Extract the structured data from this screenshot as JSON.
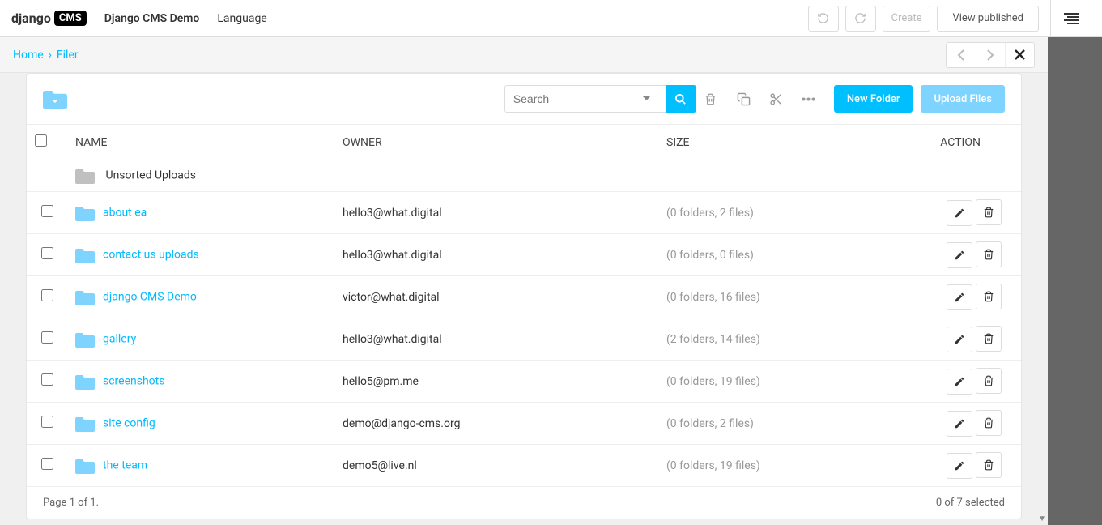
{
  "toolbar": {
    "logo_prefix": "django",
    "logo_badge": "CMS",
    "site_name": "Django CMS Demo",
    "language_label": "Language",
    "create_label": "Create",
    "view_published_label": "View published"
  },
  "breadcrumb": {
    "home": "Home",
    "separator": "›",
    "current": "Filer"
  },
  "panel_toolbar": {
    "search_placeholder": "Search",
    "new_folder_label": "New Folder",
    "upload_files_label": "Upload Files"
  },
  "table": {
    "headers": {
      "name": "NAME",
      "owner": "OWNER",
      "size": "SIZE",
      "action": "ACTION"
    },
    "unsorted_label": "Unsorted Uploads",
    "rows": [
      {
        "name": "about ea",
        "owner": "hello3@what.digital",
        "size": "(0 folders, 2 files)"
      },
      {
        "name": "contact us uploads",
        "owner": "hello3@what.digital",
        "size": "(0 folders, 0 files)"
      },
      {
        "name": "django CMS Demo",
        "owner": "victor@what.digital",
        "size": "(0 folders, 16 files)"
      },
      {
        "name": "gallery",
        "owner": "hello3@what.digital",
        "size": "(2 folders, 14 files)"
      },
      {
        "name": "screenshots",
        "owner": "hello5@pm.me",
        "size": "(0 folders, 19 files)"
      },
      {
        "name": "site config",
        "owner": "demo@django-cms.org",
        "size": "(0 folders, 2 files)"
      },
      {
        "name": "the team",
        "owner": "demo5@live.nl",
        "size": "(0 folders, 19 files)"
      }
    ]
  },
  "footer": {
    "page_text": "Page 1 of 1.",
    "selection_text": "0 of 7 selected"
  }
}
